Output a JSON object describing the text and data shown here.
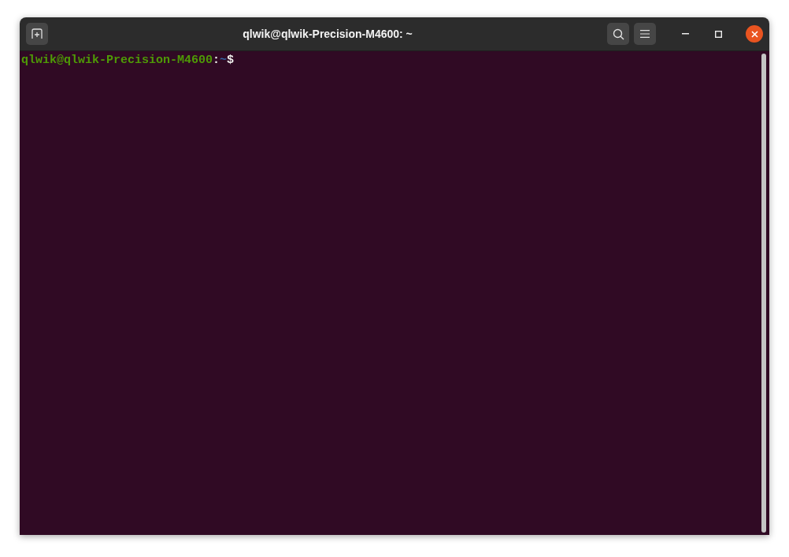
{
  "window": {
    "title": "qlwik@qlwik-Precision-M4600: ~"
  },
  "terminal": {
    "prompt": {
      "user_host": "qlwik@qlwik-Precision-M4600",
      "separator": ":",
      "path": "~",
      "symbol": "$"
    }
  }
}
